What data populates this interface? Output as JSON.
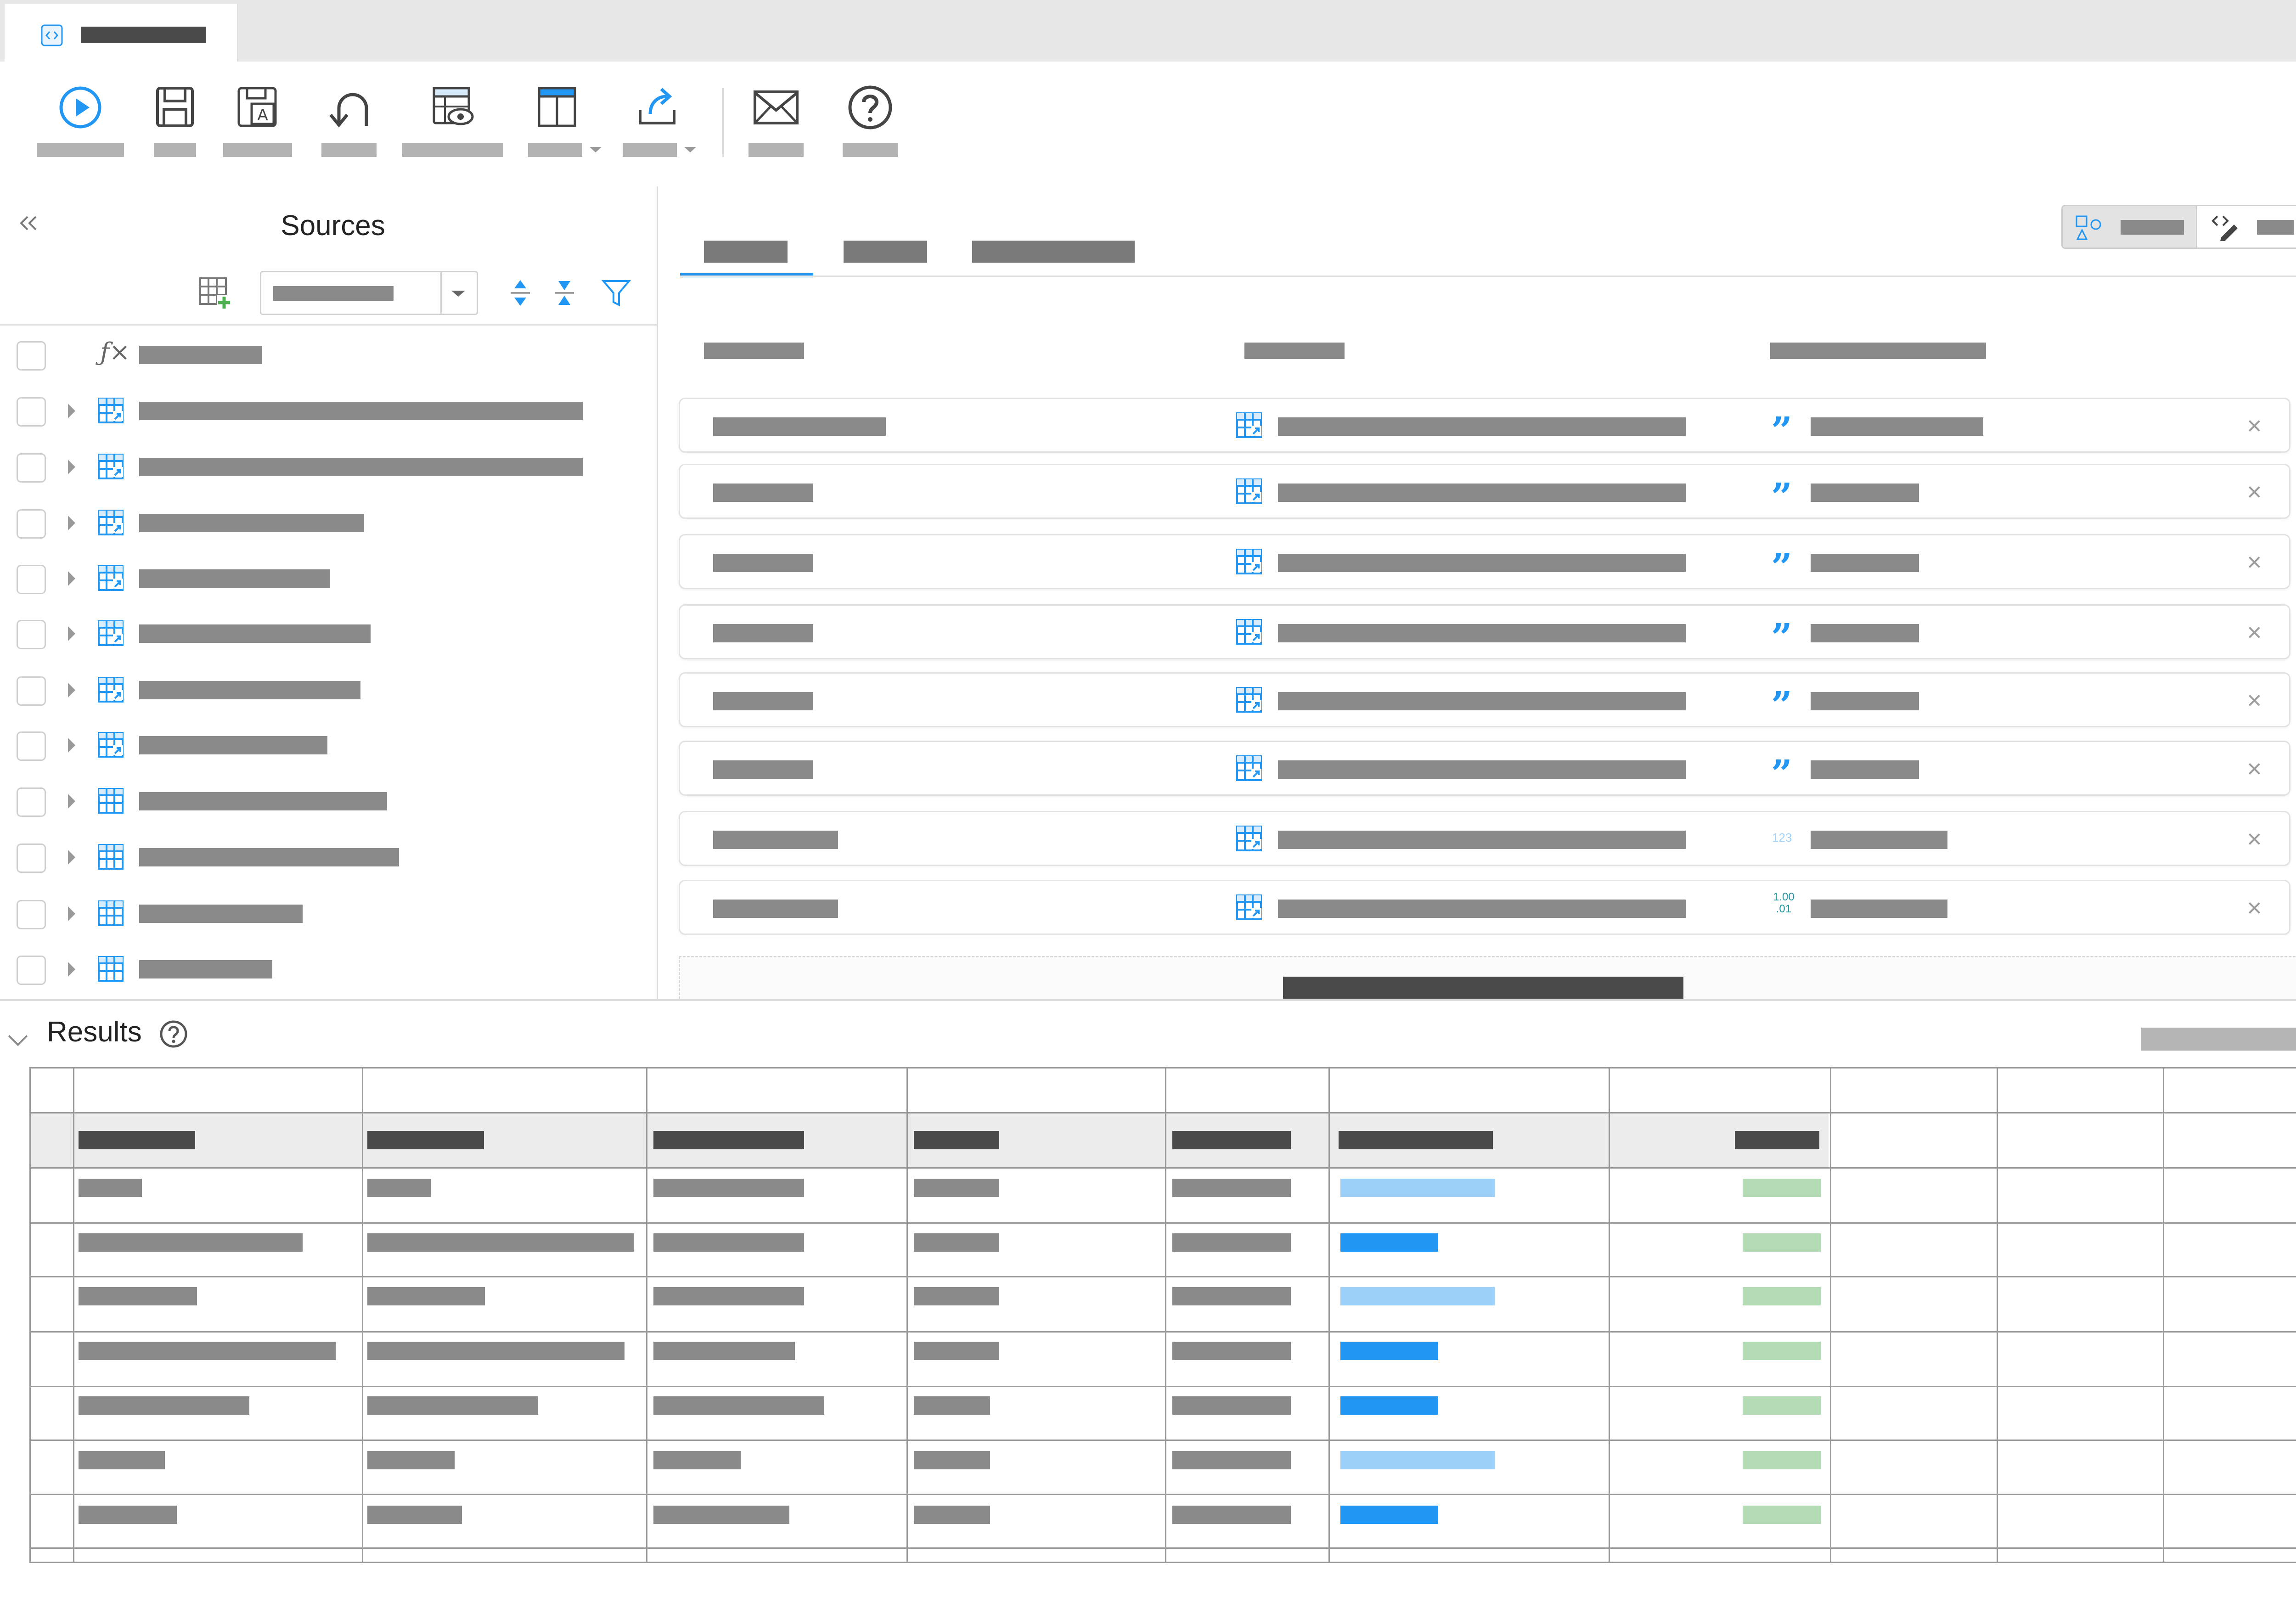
{
  "window": {
    "icon": "code-file-icon",
    "chevron": "chevron-down-icon"
  },
  "toolbar": {
    "buttons": [
      {
        "name": "run-button",
        "icon": "play-circle-icon",
        "has_dropdown": false
      },
      {
        "name": "save-button",
        "icon": "floppy-disk-icon",
        "has_dropdown": false
      },
      {
        "name": "save-as-button",
        "icon": "floppy-text-icon",
        "has_dropdown": false
      },
      {
        "name": "undo-button",
        "icon": "undo-arrow-icon",
        "has_dropdown": false
      },
      {
        "name": "preview-button",
        "icon": "table-eye-icon",
        "has_dropdown": false
      },
      {
        "name": "layout-button",
        "icon": "layout-panel-icon",
        "has_dropdown": true
      },
      {
        "name": "export-button",
        "icon": "export-arrow-icon",
        "has_dropdown": true
      },
      {
        "name": "email-button",
        "icon": "envelope-icon",
        "has_dropdown": false
      },
      {
        "name": "help-button",
        "icon": "question-circle-icon",
        "has_dropdown": false
      }
    ]
  },
  "sources": {
    "title": "Sources",
    "icons": {
      "collapse": "double-chevron-left-icon",
      "add_table": "table-add-icon",
      "expand_all": "expand-arrows-icon",
      "collapse_all": "collapse-arrows-icon",
      "filter": "filter-icon",
      "formula": "fx-icon"
    },
    "rows": [
      {
        "kind": "formula"
      },
      {
        "kind": "linked-table"
      },
      {
        "kind": "linked-table"
      },
      {
        "kind": "linked-table"
      },
      {
        "kind": "linked-table"
      },
      {
        "kind": "linked-table"
      },
      {
        "kind": "linked-table"
      },
      {
        "kind": "linked-table"
      },
      {
        "kind": "table"
      },
      {
        "kind": "table"
      },
      {
        "kind": "table"
      },
      {
        "kind": "table"
      }
    ]
  },
  "editor": {
    "view_toggle": {
      "icons": [
        "shapes-icon",
        "code-edit-icon"
      ]
    },
    "mappings": [
      {
        "type_icon": "quote-icon"
      },
      {
        "type_icon": "quote-icon"
      },
      {
        "type_icon": "quote-icon"
      },
      {
        "type_icon": "quote-icon"
      },
      {
        "type_icon": "quote-icon"
      },
      {
        "type_icon": "quote-icon"
      },
      {
        "type_icon": "integer-icon",
        "type_text": "123"
      },
      {
        "type_icon": "decimal-icon",
        "type_text_top": "1.00",
        "type_text_bottom": ".01"
      }
    ]
  },
  "rail": {
    "icons": [
      "double-chevron-left-icon",
      "gear-icon",
      "page-settings-icon",
      "sliders-icon"
    ]
  },
  "results": {
    "title": "Results",
    "help_icon": "question-circle-icon",
    "run_icon": "play-circle-icon",
    "colors": {
      "bar_light": "#9dd0f8",
      "bar_strong": "#2196f3",
      "bar_green": "#b4dcb4"
    }
  }
}
